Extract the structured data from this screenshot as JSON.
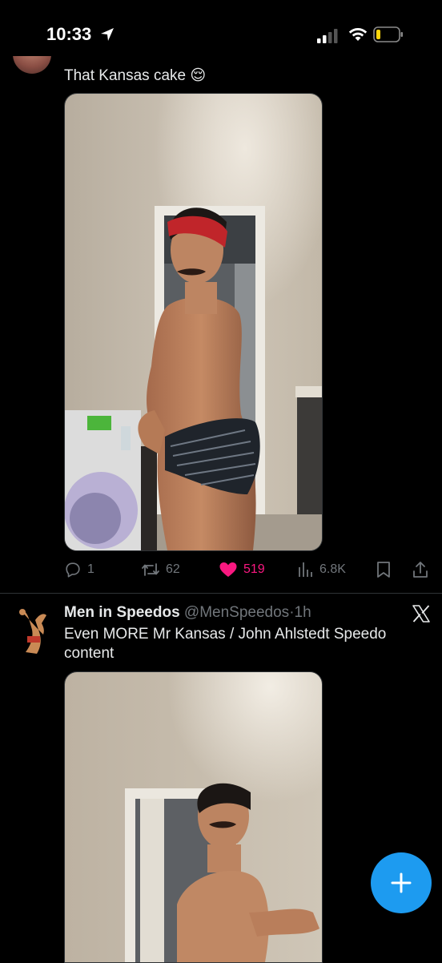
{
  "status_bar": {
    "time": "10:33",
    "icons": [
      "location-arrow-icon",
      "cellular-signal-icon",
      "wifi-icon",
      "battery-low-icon"
    ]
  },
  "tweet_1": {
    "text": "That Kansas cake 😌",
    "media": {
      "type": "video",
      "muted": true,
      "icon": "mute-icon"
    },
    "actions": {
      "replies": "1",
      "reposts": "62",
      "likes": "519",
      "views": "6.8K",
      "liked": true
    }
  },
  "tweet_2": {
    "display_name": "Men in Speedos",
    "handle": "@MenSpeedos",
    "separator": "·",
    "time": "1h",
    "text": "Even MORE Mr Kansas / John Ahlstedt Speedo content",
    "media": {
      "type": "video"
    }
  },
  "compose_button": {
    "icon": "plus-icon"
  },
  "colors": {
    "background": "#000000",
    "text": "#e7e9ea",
    "secondary": "#71767b",
    "like": "#f91880",
    "accent": "#1d9bf0",
    "divider": "#2f3336"
  }
}
